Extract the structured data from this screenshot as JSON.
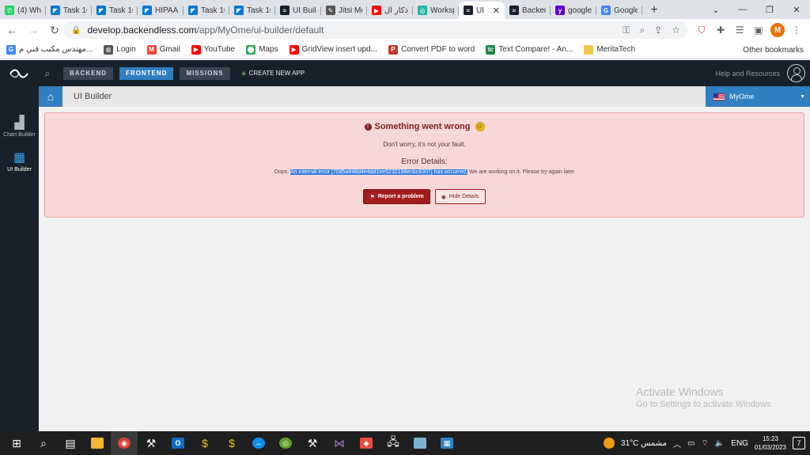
{
  "browser": {
    "tabs": [
      {
        "label": "(4) Wh",
        "icon": "whatsapp-icon",
        "color": "#25d366",
        "glyph": "✆"
      },
      {
        "label": "Task 16",
        "icon": "azure-devops-icon",
        "color": "#0078d4",
        "glyph": "◤"
      },
      {
        "label": "Task 16",
        "icon": "azure-devops-icon",
        "color": "#0078d4",
        "glyph": "◤"
      },
      {
        "label": "HIPAA",
        "icon": "azure-devops-icon",
        "color": "#0078d4",
        "glyph": "◤"
      },
      {
        "label": "Task 16",
        "icon": "azure-devops-icon",
        "color": "#0078d4",
        "glyph": "◤"
      },
      {
        "label": "Task 16",
        "icon": "azure-devops-icon",
        "color": "#0078d4",
        "glyph": "◤"
      },
      {
        "label": "UI Buil",
        "icon": "backendless-icon",
        "color": "#18212b",
        "glyph": "≈"
      },
      {
        "label": "Jitsi Me",
        "icon": "jitsi-icon",
        "color": "#555555",
        "glyph": "✎"
      },
      {
        "label": "اذكار ال",
        "icon": "youtube-icon",
        "color": "#ff0000",
        "glyph": "▶"
      },
      {
        "label": "Worksp",
        "icon": "workspace-icon",
        "color": "#27b5a4",
        "glyph": "◎"
      },
      {
        "label": "UI",
        "icon": "backendless-icon",
        "color": "#18212b",
        "glyph": "≈",
        "active": true
      },
      {
        "label": "Backen",
        "icon": "backendless-icon",
        "color": "#18212b",
        "glyph": "≈"
      },
      {
        "label": "google",
        "icon": "yahoo-icon",
        "color": "#6001d2",
        "glyph": "y"
      },
      {
        "label": "Google",
        "icon": "translate-icon",
        "color": "#4285f4",
        "glyph": "G"
      }
    ],
    "url_host": "develop.backendless.com",
    "url_path": "/app/MyOme/ui-builder/default",
    "bookmarks": [
      {
        "label": "مهندس مكتب فني م...",
        "icon": "google-icon",
        "color": "#4285f4",
        "glyph": "G"
      },
      {
        "label": "Login",
        "icon": "globe-icon",
        "color": "#555555",
        "glyph": "◍"
      },
      {
        "label": "Gmail",
        "icon": "gmail-icon",
        "color": "#ea4335",
        "glyph": "M"
      },
      {
        "label": "YouTube",
        "icon": "youtube-icon",
        "color": "#ff0000",
        "glyph": "▶"
      },
      {
        "label": "Maps",
        "icon": "maps-icon",
        "color": "#34a853",
        "glyph": "⬤"
      },
      {
        "label": "GridView insert upd...",
        "icon": "youtube-icon",
        "color": "#ff0000",
        "glyph": "▶"
      },
      {
        "label": "Convert PDF to word",
        "icon": "pdf-icon",
        "color": "#c0392b",
        "glyph": "P"
      },
      {
        "label": "Text Compare! - An...",
        "icon": "textcompare-icon",
        "color": "#1e8449",
        "glyph": "tc"
      },
      {
        "label": "MeritaTech",
        "icon": "folder-icon",
        "color": "#f2c94c",
        "glyph": ""
      }
    ],
    "other_bookmarks": "Other bookmarks",
    "profile_initial": "M"
  },
  "app": {
    "nav": {
      "backend": "BACKEND",
      "frontend": "FRONTEND",
      "missions": "MISSIONS",
      "create_app": "CREATE NEW APP"
    },
    "help": "Help and Resources",
    "sidebar": {
      "chart_builder": "Chart Builder",
      "ui_builder": "UI Builder"
    },
    "page_title": "UI Builder",
    "app_name": "MyOme"
  },
  "error": {
    "title": "Something went wrong",
    "subtitle": "Don't worry, it's not your fault.",
    "details_title": "Error Details:",
    "msg_prefix": "Oops. ",
    "msg_highlight": "An internal error [70d5a946d4e4dd1ee5232198ecbc8307] has occurred.",
    "msg_suffix": " We are working on it. Please try again later",
    "report_button": "Report a problem",
    "hide_button": "Hide Details"
  },
  "watermark": {
    "title": "Activate Windows",
    "subtitle": "Go to Settings to activate Windows."
  },
  "taskbar": {
    "weather": "31°C مشمس",
    "language": "ENG",
    "time": "15:23",
    "date": "01/03/2023",
    "notifications": "7"
  }
}
